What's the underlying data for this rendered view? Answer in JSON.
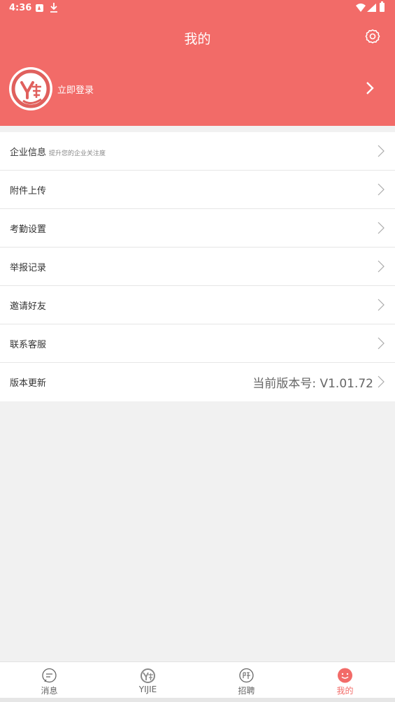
{
  "status_bar": {
    "time": "4:36",
    "icons": [
      "notification-a-icon",
      "download-icon",
      "wifi-icon",
      "signal-icon",
      "battery-icon"
    ]
  },
  "header": {
    "title": "我的",
    "settings_icon": "gear-icon",
    "login_text": "立即登录",
    "background_color": "#f26b68"
  },
  "menu": {
    "items": [
      {
        "label": "企业信息",
        "sub": "提升您的企业关注度"
      },
      {
        "label": "附件上传"
      },
      {
        "label": "考勤设置"
      },
      {
        "label": "举报记录"
      },
      {
        "label": "邀请好友"
      },
      {
        "label": "联系客服"
      },
      {
        "label": "版本更新",
        "value": "当前版本号: V1.01.72"
      }
    ]
  },
  "tabbar": {
    "tabs": [
      {
        "label": "消息",
        "icon": "message-icon"
      },
      {
        "label": "YIJIE",
        "icon": "yijie-logo-icon"
      },
      {
        "label": "招聘",
        "icon": "recruit-icon"
      },
      {
        "label": "我的",
        "icon": "smile-icon",
        "active": true
      }
    ],
    "active_color": "#f26b68"
  }
}
